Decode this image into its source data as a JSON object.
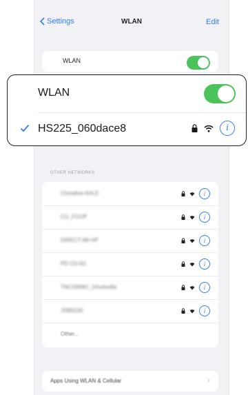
{
  "nav": {
    "back_label": "Settings",
    "title": "WLAN",
    "edit_label": "Edit"
  },
  "wlan_toggle": {
    "label": "WLAN",
    "on": true
  },
  "callout": {
    "wlan_label": "WLAN",
    "connected_ssid": "HS225_060dace8"
  },
  "other_networks": {
    "header": "OTHER NETWORKS",
    "items": [
      {
        "name": "Chinaline-6XLE"
      },
      {
        "name": "CU_FOUP"
      },
      {
        "name": "DIRECT-88-HP"
      },
      {
        "name": "PD-C0-0G"
      },
      {
        "name": "TNCD099C_0Axdxe8a"
      },
      {
        "name": "JSB9100"
      }
    ],
    "other_label": "Other..."
  },
  "apps_row": {
    "label": "Apps Using WLAN & Cellular"
  },
  "colors": {
    "accent": "#2f7cf6",
    "toggle_on": "#4bc25a",
    "background": "#f2f2f6"
  },
  "icons": {
    "back": "chevron-left-icon",
    "lock": "lock-icon",
    "wifi": "wifi-icon",
    "info": "info-icon",
    "check": "checkmark-icon",
    "chevron": "chevron-right-icon"
  }
}
